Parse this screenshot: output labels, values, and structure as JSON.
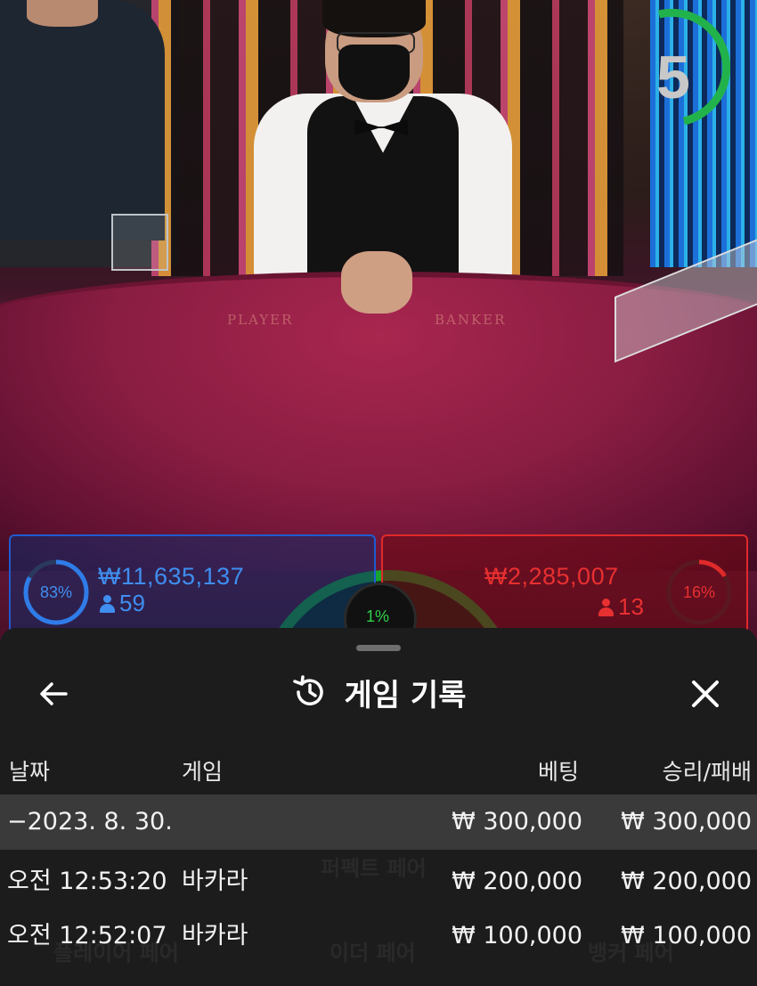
{
  "timer": {
    "value": "5",
    "progress": 0.33,
    "color": "#22b24c"
  },
  "table_felt": {
    "player_label": "PLAYER",
    "banker_label": "BANKER"
  },
  "bets": {
    "player": {
      "percent": "83%",
      "percent_value": 0.83,
      "amount": "₩11,635,137",
      "players": "59",
      "color": "#2f7ce8"
    },
    "banker": {
      "percent": "16%",
      "percent_value": 0.16,
      "amount": "₩2,285,007",
      "players": "13",
      "color": "#e02a2a"
    },
    "tie": {
      "percent": "1%",
      "color": "#17a32e"
    }
  },
  "sheet": {
    "title": "게임 기록",
    "columns": {
      "date": "날짜",
      "game": "게임",
      "bet": "베팅",
      "result": "승리/패배"
    },
    "rows": [
      {
        "date": "−2023. 8. 30.",
        "game": "",
        "bet": "₩ 300,000",
        "result": "₩ 300,000",
        "highlight": true
      },
      {
        "date": "오전 12:53:20",
        "game": "바카라",
        "bet": "₩ 200,000",
        "result": "₩ 200,000",
        "highlight": false
      },
      {
        "date": "오전 12:52:07",
        "game": "바카라",
        "bet": "₩ 100,000",
        "result": "₩ 100,000",
        "highlight": false
      }
    ]
  }
}
